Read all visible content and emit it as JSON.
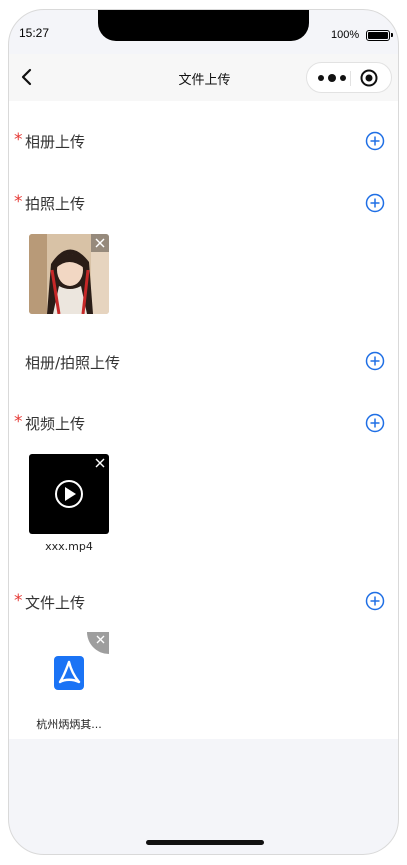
{
  "status_bar": {
    "time": "15:27",
    "battery_text": "100%",
    "battery_level_percent": 100
  },
  "navbar": {
    "title": "文件上传",
    "back_icon": "chevron-left-icon",
    "more_icon": "more-dots-icon",
    "close_icon": "target-circle-icon"
  },
  "sections": [
    {
      "label": "相册上传",
      "required": true,
      "required_mark": "*",
      "add_icon": "plus-circle-icon"
    },
    {
      "label": "拍照上传",
      "required": true,
      "required_mark": "*",
      "add_icon": "plus-circle-icon",
      "items": [
        {
          "type": "image",
          "subject": "photo"
        }
      ]
    },
    {
      "label": "相册/拍照上传",
      "required": false,
      "add_icon": "plus-circle-icon"
    },
    {
      "label": "视频上传",
      "required": true,
      "required_mark": "*",
      "add_icon": "plus-circle-icon",
      "items": [
        {
          "type": "video",
          "name": "xxx.mp4",
          "icon": "play-icon"
        }
      ]
    },
    {
      "label": "文件上传",
      "required": true,
      "required_mark": "*",
      "add_icon": "plus-circle-icon",
      "items": [
        {
          "type": "pdf",
          "name": "杭州炳炳其...",
          "icon": "pdf-icon"
        }
      ]
    }
  ],
  "colors": {
    "accent": "#1f6fe5",
    "required": "#e53935",
    "page_bg": "#f4f5f9",
    "pdf_icon_bg": "#1a73f5"
  }
}
